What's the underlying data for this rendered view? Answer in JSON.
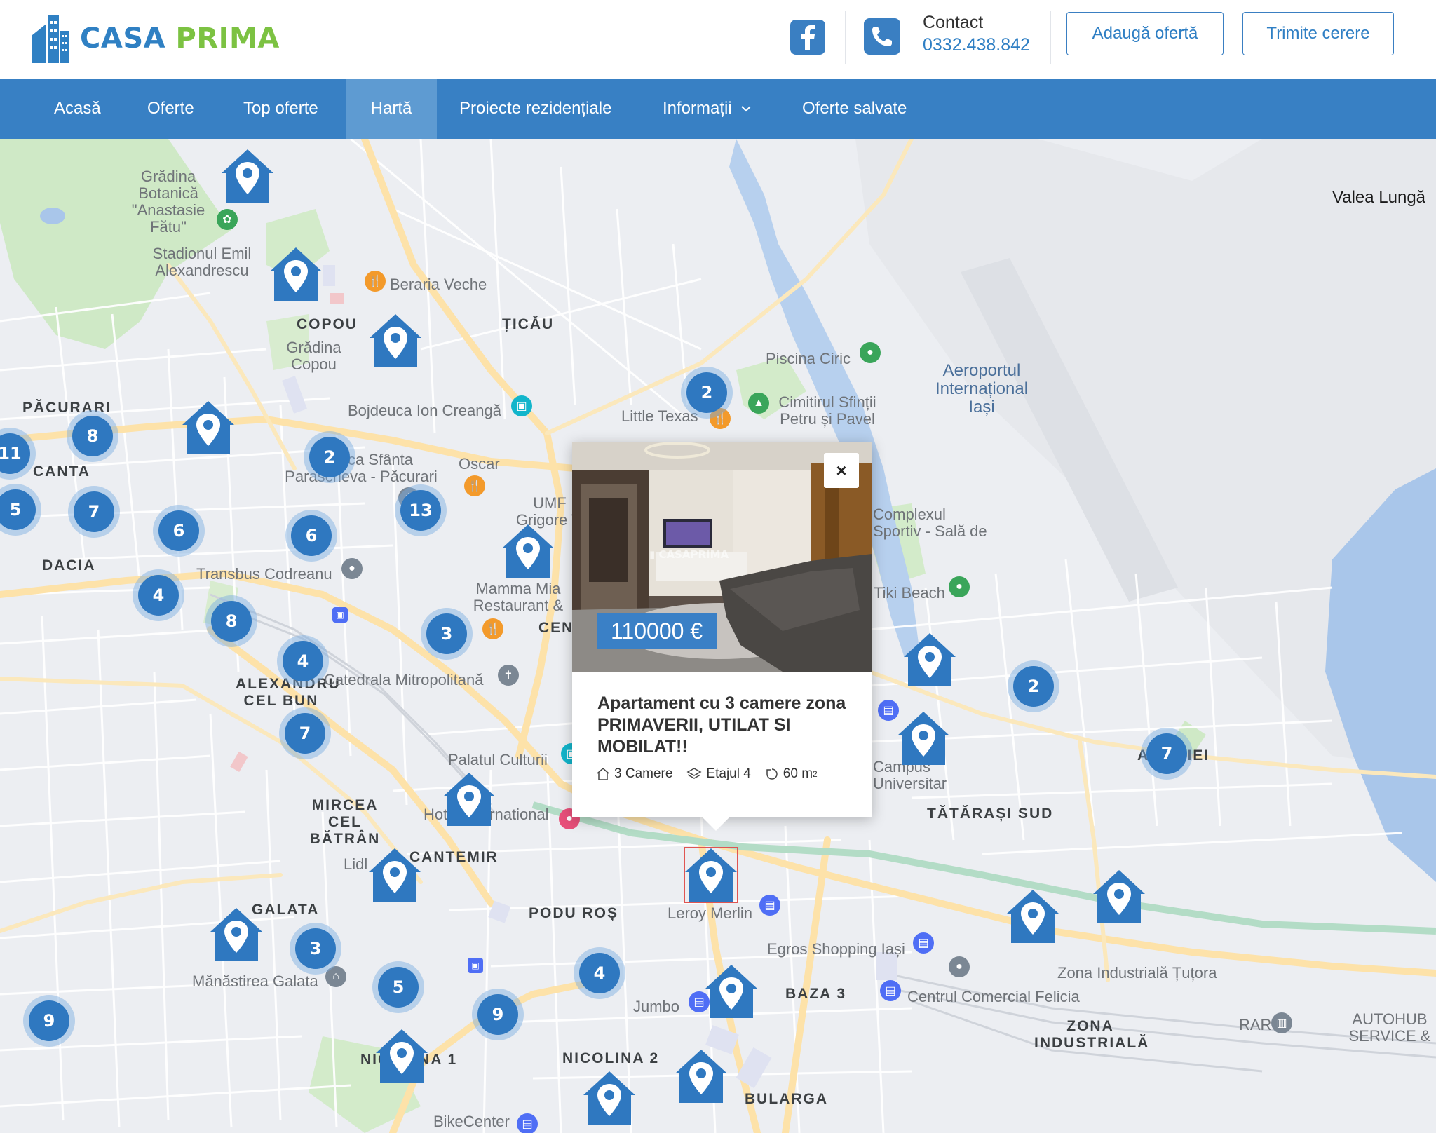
{
  "brand": {
    "name_part1": "CASA",
    "name_part2": "PRIMA",
    "color_blue": "#2f80c3",
    "color_green": "#7cc242"
  },
  "header": {
    "contact_label": "Contact",
    "contact_phone": "0332.438.842",
    "add_offer": "Adaugă ofertă",
    "send_request": "Trimite cerere"
  },
  "nav": {
    "items": [
      "Acasă",
      "Oferte",
      "Top oferte",
      "Hartă",
      "Proiecte rezidențiale",
      "Informații",
      "Oferte salvate"
    ],
    "active": "Hartă"
  },
  "map": {
    "districts": [
      "COPOU",
      "ȚICĂU",
      "PĂCURARI",
      "CANTA",
      "DACIA",
      "ALEXANDRU CEL BUN",
      "MIRCEA CEL BĂTRÂN",
      "CANTEMIR",
      "GALATA",
      "PODU ROȘ",
      "NICOLINA 1",
      "NICOLINA 2",
      "BAZA 3",
      "BULARGA",
      "TĂTĂRAȘI SUD",
      "AVIAȚIEI",
      "ZONA INDUSTRIALĂ",
      "CENTRU"
    ],
    "places": [
      "Grădina Botanică \"Anastasie Fătu\"",
      "Stadionul Emil Alexandrescu",
      "Beraria Veche",
      "Grădina Copou",
      "Bojdeuca Ion Creangă",
      "Piscina Ciric",
      "Little Texas",
      "Cimitirul Sfinții Petru și Pavel",
      "Biserica Sfânta Parascheva - Păcurari",
      "Oscar",
      "UMF Grigore T. Popa Iași",
      "Transbus Codreanu",
      "Mamma Mia Restaurant & Club",
      "Catedrala Mitropolitană",
      "Palatul Culturii",
      "Hotel International",
      "Lidl",
      "Mănăstirea Galata",
      "Leroy Merlin",
      "Egros Shopping Iași",
      "Jumbo",
      "Centrul Comercial Felicia",
      "Zona Industrială Țuțora",
      "RAR",
      "AUTOHUB SERVICE & DETAILING",
      "BikeCenter",
      "Campus Universitar Tudor Vladimirescu",
      "Complexul Sportiv - Sală de Baschet și Sala de Sport Iași",
      "Tiki Beach",
      "Valea Lungă",
      "Aeroportul Internațional Iași"
    ],
    "cluster_counts": [
      11,
      8,
      5,
      7,
      6,
      4,
      8,
      4,
      7,
      2,
      13,
      6,
      3,
      2,
      3,
      2,
      7,
      3,
      5,
      9,
      9,
      4
    ],
    "colors": {
      "cluster": "#2f78c0",
      "marker": "#2f78c0",
      "road_major": "#fde2a9",
      "water": "#a9c6ea",
      "park": "#cfe9c6"
    }
  },
  "popup": {
    "price": "110000 €",
    "title": "Apartament cu 3 camere zona PRIMAVERII, UTILAT SI MOBILAT!!",
    "rooms": "3 Camere",
    "floor": "Etajul 4",
    "area": "60 m",
    "area_sup": "2",
    "watermark": "CASAPRIMA",
    "close": "×"
  },
  "icons": [
    "building-logo-icon",
    "facebook-icon",
    "phone-icon",
    "chevron-down-icon",
    "house-pin-icon",
    "close-icon",
    "home-icon",
    "layers-icon",
    "area-icon"
  ]
}
